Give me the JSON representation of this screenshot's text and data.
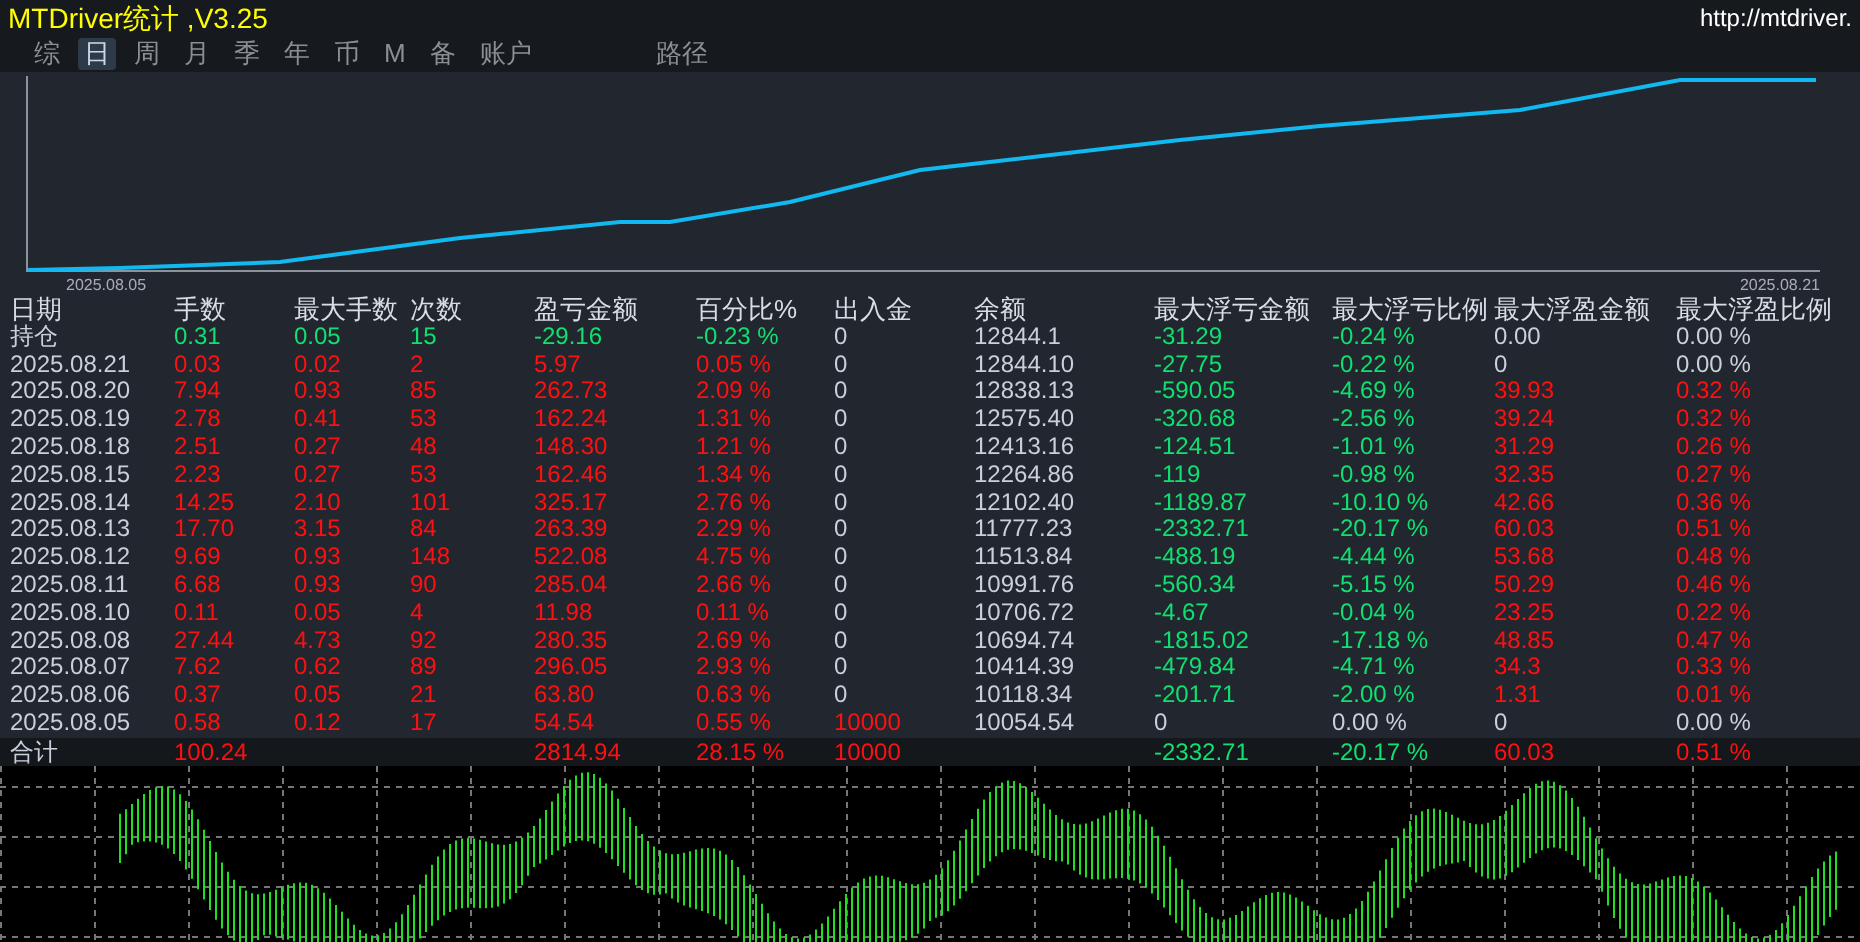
{
  "window": {
    "title": "MTDriver统计 ,V3.25",
    "link": "http://mtdriver."
  },
  "tabs": [
    {
      "label": "综",
      "selected": false
    },
    {
      "label": "日",
      "selected": true
    },
    {
      "label": "周",
      "selected": false
    },
    {
      "label": "月",
      "selected": false
    },
    {
      "label": "季",
      "selected": false
    },
    {
      "label": "年",
      "selected": false
    },
    {
      "label": "币",
      "selected": false
    },
    {
      "label": "M",
      "selected": false
    },
    {
      "label": "备",
      "selected": false
    },
    {
      "label": "账户",
      "selected": false
    },
    {
      "label": "路径",
      "selected": false
    }
  ],
  "equity_chart": {
    "start_label": "2025.08.05",
    "end_label": "2025.08.21"
  },
  "table": {
    "columns": [
      "日期",
      "手数",
      "最大手数",
      "次数",
      "盈亏金额",
      "百分比%",
      "出入金",
      "余额",
      "最大浮亏金额",
      "最大浮亏比例",
      "最大浮盈金额",
      "最大浮盈比例"
    ],
    "rows": [
      {
        "cells": [
          {
            "text": "持仓",
            "color": "#c8d0dc"
          },
          {
            "text": "0.31",
            "color": "#10e070"
          },
          {
            "text": "0.05",
            "color": "#10e070"
          },
          {
            "text": "15",
            "color": "#10e070"
          },
          {
            "text": "-29.16",
            "color": "#10e070"
          },
          {
            "text": "-0.23 %",
            "color": "#10e070"
          },
          {
            "text": "0",
            "color": "#c8d0dc"
          },
          {
            "text": "12844.1",
            "color": "#c8d0dc"
          },
          {
            "text": "-31.29",
            "color": "#10e070"
          },
          {
            "text": "-0.24 %",
            "color": "#10e070"
          },
          {
            "text": "0.00",
            "color": "#c8d0dc"
          },
          {
            "text": "0.00 %",
            "color": "#c8d0dc"
          }
        ]
      },
      {
        "cells": [
          {
            "text": "2025.08.21",
            "color": "#c8d0dc"
          },
          {
            "text": "0.03",
            "color": "#ff1010"
          },
          {
            "text": "0.02",
            "color": "#ff1010"
          },
          {
            "text": "2",
            "color": "#ff1010"
          },
          {
            "text": "5.97",
            "color": "#ff1010"
          },
          {
            "text": "0.05 %",
            "color": "#ff1010"
          },
          {
            "text": "0",
            "color": "#c8d0dc"
          },
          {
            "text": "12844.10",
            "color": "#c8d0dc"
          },
          {
            "text": "-27.75",
            "color": "#10e070"
          },
          {
            "text": "-0.22 %",
            "color": "#10e070"
          },
          {
            "text": "0",
            "color": "#c8d0dc"
          },
          {
            "text": "0.00 %",
            "color": "#c8d0dc"
          }
        ]
      },
      {
        "cells": [
          {
            "text": "2025.08.20",
            "color": "#c8d0dc"
          },
          {
            "text": "7.94",
            "color": "#ff1010"
          },
          {
            "text": "0.93",
            "color": "#ff1010"
          },
          {
            "text": "85",
            "color": "#ff1010"
          },
          {
            "text": "262.73",
            "color": "#ff1010"
          },
          {
            "text": "2.09 %",
            "color": "#ff1010"
          },
          {
            "text": "0",
            "color": "#c8d0dc"
          },
          {
            "text": "12838.13",
            "color": "#c8d0dc"
          },
          {
            "text": "-590.05",
            "color": "#10e070"
          },
          {
            "text": "-4.69 %",
            "color": "#10e070"
          },
          {
            "text": "39.93",
            "color": "#ff1010"
          },
          {
            "text": "0.32 %",
            "color": "#ff1010"
          }
        ]
      },
      {
        "cells": [
          {
            "text": "2025.08.19",
            "color": "#c8d0dc"
          },
          {
            "text": "2.78",
            "color": "#ff1010"
          },
          {
            "text": "0.41",
            "color": "#ff1010"
          },
          {
            "text": "53",
            "color": "#ff1010"
          },
          {
            "text": "162.24",
            "color": "#ff1010"
          },
          {
            "text": "1.31 %",
            "color": "#ff1010"
          },
          {
            "text": "0",
            "color": "#c8d0dc"
          },
          {
            "text": "12575.40",
            "color": "#c8d0dc"
          },
          {
            "text": "-320.68",
            "color": "#10e070"
          },
          {
            "text": "-2.56 %",
            "color": "#10e070"
          },
          {
            "text": "39.24",
            "color": "#ff1010"
          },
          {
            "text": "0.32 %",
            "color": "#ff1010"
          }
        ]
      },
      {
        "cells": [
          {
            "text": "2025.08.18",
            "color": "#c8d0dc"
          },
          {
            "text": "2.51",
            "color": "#ff1010"
          },
          {
            "text": "0.27",
            "color": "#ff1010"
          },
          {
            "text": "48",
            "color": "#ff1010"
          },
          {
            "text": "148.30",
            "color": "#ff1010"
          },
          {
            "text": "1.21 %",
            "color": "#ff1010"
          },
          {
            "text": "0",
            "color": "#c8d0dc"
          },
          {
            "text": "12413.16",
            "color": "#c8d0dc"
          },
          {
            "text": "-124.51",
            "color": "#10e070"
          },
          {
            "text": "-1.01 %",
            "color": "#10e070"
          },
          {
            "text": "31.29",
            "color": "#ff1010"
          },
          {
            "text": "0.26 %",
            "color": "#ff1010"
          }
        ]
      },
      {
        "cells": [
          {
            "text": "2025.08.15",
            "color": "#c8d0dc"
          },
          {
            "text": "2.23",
            "color": "#ff1010"
          },
          {
            "text": "0.27",
            "color": "#ff1010"
          },
          {
            "text": "53",
            "color": "#ff1010"
          },
          {
            "text": "162.46",
            "color": "#ff1010"
          },
          {
            "text": "1.34 %",
            "color": "#ff1010"
          },
          {
            "text": "0",
            "color": "#c8d0dc"
          },
          {
            "text": "12264.86",
            "color": "#c8d0dc"
          },
          {
            "text": "-119",
            "color": "#10e070"
          },
          {
            "text": "-0.98 %",
            "color": "#10e070"
          },
          {
            "text": "32.35",
            "color": "#ff1010"
          },
          {
            "text": "0.27 %",
            "color": "#ff1010"
          }
        ]
      },
      {
        "cells": [
          {
            "text": "2025.08.14",
            "color": "#c8d0dc"
          },
          {
            "text": "14.25",
            "color": "#ff1010"
          },
          {
            "text": "2.10",
            "color": "#ff1010"
          },
          {
            "text": "101",
            "color": "#ff1010"
          },
          {
            "text": "325.17",
            "color": "#ff1010"
          },
          {
            "text": "2.76 %",
            "color": "#ff1010"
          },
          {
            "text": "0",
            "color": "#c8d0dc"
          },
          {
            "text": "12102.40",
            "color": "#c8d0dc"
          },
          {
            "text": "-1189.87",
            "color": "#10e070"
          },
          {
            "text": "-10.10 %",
            "color": "#10e070"
          },
          {
            "text": "42.66",
            "color": "#ff1010"
          },
          {
            "text": "0.36 %",
            "color": "#ff1010"
          }
        ]
      },
      {
        "cells": [
          {
            "text": "2025.08.13",
            "color": "#c8d0dc"
          },
          {
            "text": "17.70",
            "color": "#ff1010"
          },
          {
            "text": "3.15",
            "color": "#ff1010"
          },
          {
            "text": "84",
            "color": "#ff1010"
          },
          {
            "text": "263.39",
            "color": "#ff1010"
          },
          {
            "text": "2.29 %",
            "color": "#ff1010"
          },
          {
            "text": "0",
            "color": "#c8d0dc"
          },
          {
            "text": "11777.23",
            "color": "#c8d0dc"
          },
          {
            "text": "-2332.71",
            "color": "#10e070"
          },
          {
            "text": "-20.17 %",
            "color": "#10e070"
          },
          {
            "text": "60.03",
            "color": "#ff1010"
          },
          {
            "text": "0.51 %",
            "color": "#ff1010"
          }
        ]
      },
      {
        "cells": [
          {
            "text": "2025.08.12",
            "color": "#c8d0dc"
          },
          {
            "text": "9.69",
            "color": "#ff1010"
          },
          {
            "text": "0.93",
            "color": "#ff1010"
          },
          {
            "text": "148",
            "color": "#ff1010"
          },
          {
            "text": "522.08",
            "color": "#ff1010"
          },
          {
            "text": "4.75 %",
            "color": "#ff1010"
          },
          {
            "text": "0",
            "color": "#c8d0dc"
          },
          {
            "text": "11513.84",
            "color": "#c8d0dc"
          },
          {
            "text": "-488.19",
            "color": "#10e070"
          },
          {
            "text": "-4.44 %",
            "color": "#10e070"
          },
          {
            "text": "53.68",
            "color": "#ff1010"
          },
          {
            "text": "0.48 %",
            "color": "#ff1010"
          }
        ]
      },
      {
        "cells": [
          {
            "text": "2025.08.11",
            "color": "#c8d0dc"
          },
          {
            "text": "6.68",
            "color": "#ff1010"
          },
          {
            "text": "0.93",
            "color": "#ff1010"
          },
          {
            "text": "90",
            "color": "#ff1010"
          },
          {
            "text": "285.04",
            "color": "#ff1010"
          },
          {
            "text": "2.66 %",
            "color": "#ff1010"
          },
          {
            "text": "0",
            "color": "#c8d0dc"
          },
          {
            "text": "10991.76",
            "color": "#c8d0dc"
          },
          {
            "text": "-560.34",
            "color": "#10e070"
          },
          {
            "text": "-5.15 %",
            "color": "#10e070"
          },
          {
            "text": "50.29",
            "color": "#ff1010"
          },
          {
            "text": "0.46 %",
            "color": "#ff1010"
          }
        ]
      },
      {
        "cells": [
          {
            "text": "2025.08.10",
            "color": "#c8d0dc"
          },
          {
            "text": "0.11",
            "color": "#ff1010"
          },
          {
            "text": "0.05",
            "color": "#ff1010"
          },
          {
            "text": "4",
            "color": "#ff1010"
          },
          {
            "text": "11.98",
            "color": "#ff1010"
          },
          {
            "text": "0.11 %",
            "color": "#ff1010"
          },
          {
            "text": "0",
            "color": "#c8d0dc"
          },
          {
            "text": "10706.72",
            "color": "#c8d0dc"
          },
          {
            "text": "-4.67",
            "color": "#10e070"
          },
          {
            "text": "-0.04 %",
            "color": "#10e070"
          },
          {
            "text": "23.25",
            "color": "#ff1010"
          },
          {
            "text": "0.22 %",
            "color": "#ff1010"
          }
        ]
      },
      {
        "cells": [
          {
            "text": "2025.08.08",
            "color": "#c8d0dc"
          },
          {
            "text": "27.44",
            "color": "#ff1010"
          },
          {
            "text": "4.73",
            "color": "#ff1010"
          },
          {
            "text": "92",
            "color": "#ff1010"
          },
          {
            "text": "280.35",
            "color": "#ff1010"
          },
          {
            "text": "2.69 %",
            "color": "#ff1010"
          },
          {
            "text": "0",
            "color": "#c8d0dc"
          },
          {
            "text": "10694.74",
            "color": "#c8d0dc"
          },
          {
            "text": "-1815.02",
            "color": "#10e070"
          },
          {
            "text": "-17.18 %",
            "color": "#10e070"
          },
          {
            "text": "48.85",
            "color": "#ff1010"
          },
          {
            "text": "0.47 %",
            "color": "#ff1010"
          }
        ]
      },
      {
        "cells": [
          {
            "text": "2025.08.07",
            "color": "#c8d0dc"
          },
          {
            "text": "7.62",
            "color": "#ff1010"
          },
          {
            "text": "0.62",
            "color": "#ff1010"
          },
          {
            "text": "89",
            "color": "#ff1010"
          },
          {
            "text": "296.05",
            "color": "#ff1010"
          },
          {
            "text": "2.93 %",
            "color": "#ff1010"
          },
          {
            "text": "0",
            "color": "#c8d0dc"
          },
          {
            "text": "10414.39",
            "color": "#c8d0dc"
          },
          {
            "text": "-479.84",
            "color": "#10e070"
          },
          {
            "text": "-4.71 %",
            "color": "#10e070"
          },
          {
            "text": "34.3",
            "color": "#ff1010"
          },
          {
            "text": "0.33 %",
            "color": "#ff1010"
          }
        ]
      },
      {
        "cells": [
          {
            "text": "2025.08.06",
            "color": "#c8d0dc"
          },
          {
            "text": "0.37",
            "color": "#ff1010"
          },
          {
            "text": "0.05",
            "color": "#ff1010"
          },
          {
            "text": "21",
            "color": "#ff1010"
          },
          {
            "text": "63.80",
            "color": "#ff1010"
          },
          {
            "text": "0.63 %",
            "color": "#ff1010"
          },
          {
            "text": "0",
            "color": "#c8d0dc"
          },
          {
            "text": "10118.34",
            "color": "#c8d0dc"
          },
          {
            "text": "-201.71",
            "color": "#10e070"
          },
          {
            "text": "-2.00 %",
            "color": "#10e070"
          },
          {
            "text": "1.31",
            "color": "#ff1010"
          },
          {
            "text": "0.01 %",
            "color": "#ff1010"
          }
        ]
      },
      {
        "cells": [
          {
            "text": "2025.08.05",
            "color": "#c8d0dc"
          },
          {
            "text": "0.58",
            "color": "#ff1010"
          },
          {
            "text": "0.12",
            "color": "#ff1010"
          },
          {
            "text": "17",
            "color": "#ff1010"
          },
          {
            "text": "54.54",
            "color": "#ff1010"
          },
          {
            "text": "0.55 %",
            "color": "#ff1010"
          },
          {
            "text": "10000",
            "color": "#ff1010"
          },
          {
            "text": "10054.54",
            "color": "#c8d0dc"
          },
          {
            "text": "0",
            "color": "#c8d0dc"
          },
          {
            "text": "0.00 %",
            "color": "#c8d0dc"
          },
          {
            "text": "0",
            "color": "#c8d0dc"
          },
          {
            "text": "0.00 %",
            "color": "#c8d0dc"
          }
        ]
      }
    ],
    "total": [
      {
        "kind": "value",
        "text": "合计",
        "color": "#c8d0dc"
      },
      {
        "kind": "value",
        "text": "100.24",
        "color": "#ff1010"
      },
      {
        "kind": "blank"
      },
      {
        "kind": "blank"
      },
      {
        "kind": "value",
        "text": "2814.94",
        "color": "#ff1010"
      },
      {
        "kind": "value",
        "text": "28.15 %",
        "color": "#ff1010"
      },
      {
        "kind": "value",
        "text": "10000",
        "color": "#ff1010"
      },
      {
        "kind": "blank"
      },
      {
        "kind": "value",
        "text": "-2332.71",
        "color": "#10e070"
      },
      {
        "kind": "value",
        "text": "-20.17 %",
        "color": "#10e070"
      },
      {
        "kind": "value",
        "text": "60.03",
        "color": "#ff1010"
      },
      {
        "kind": "value",
        "text": "0.51 %",
        "color": "#ff1010"
      }
    ]
  }
}
